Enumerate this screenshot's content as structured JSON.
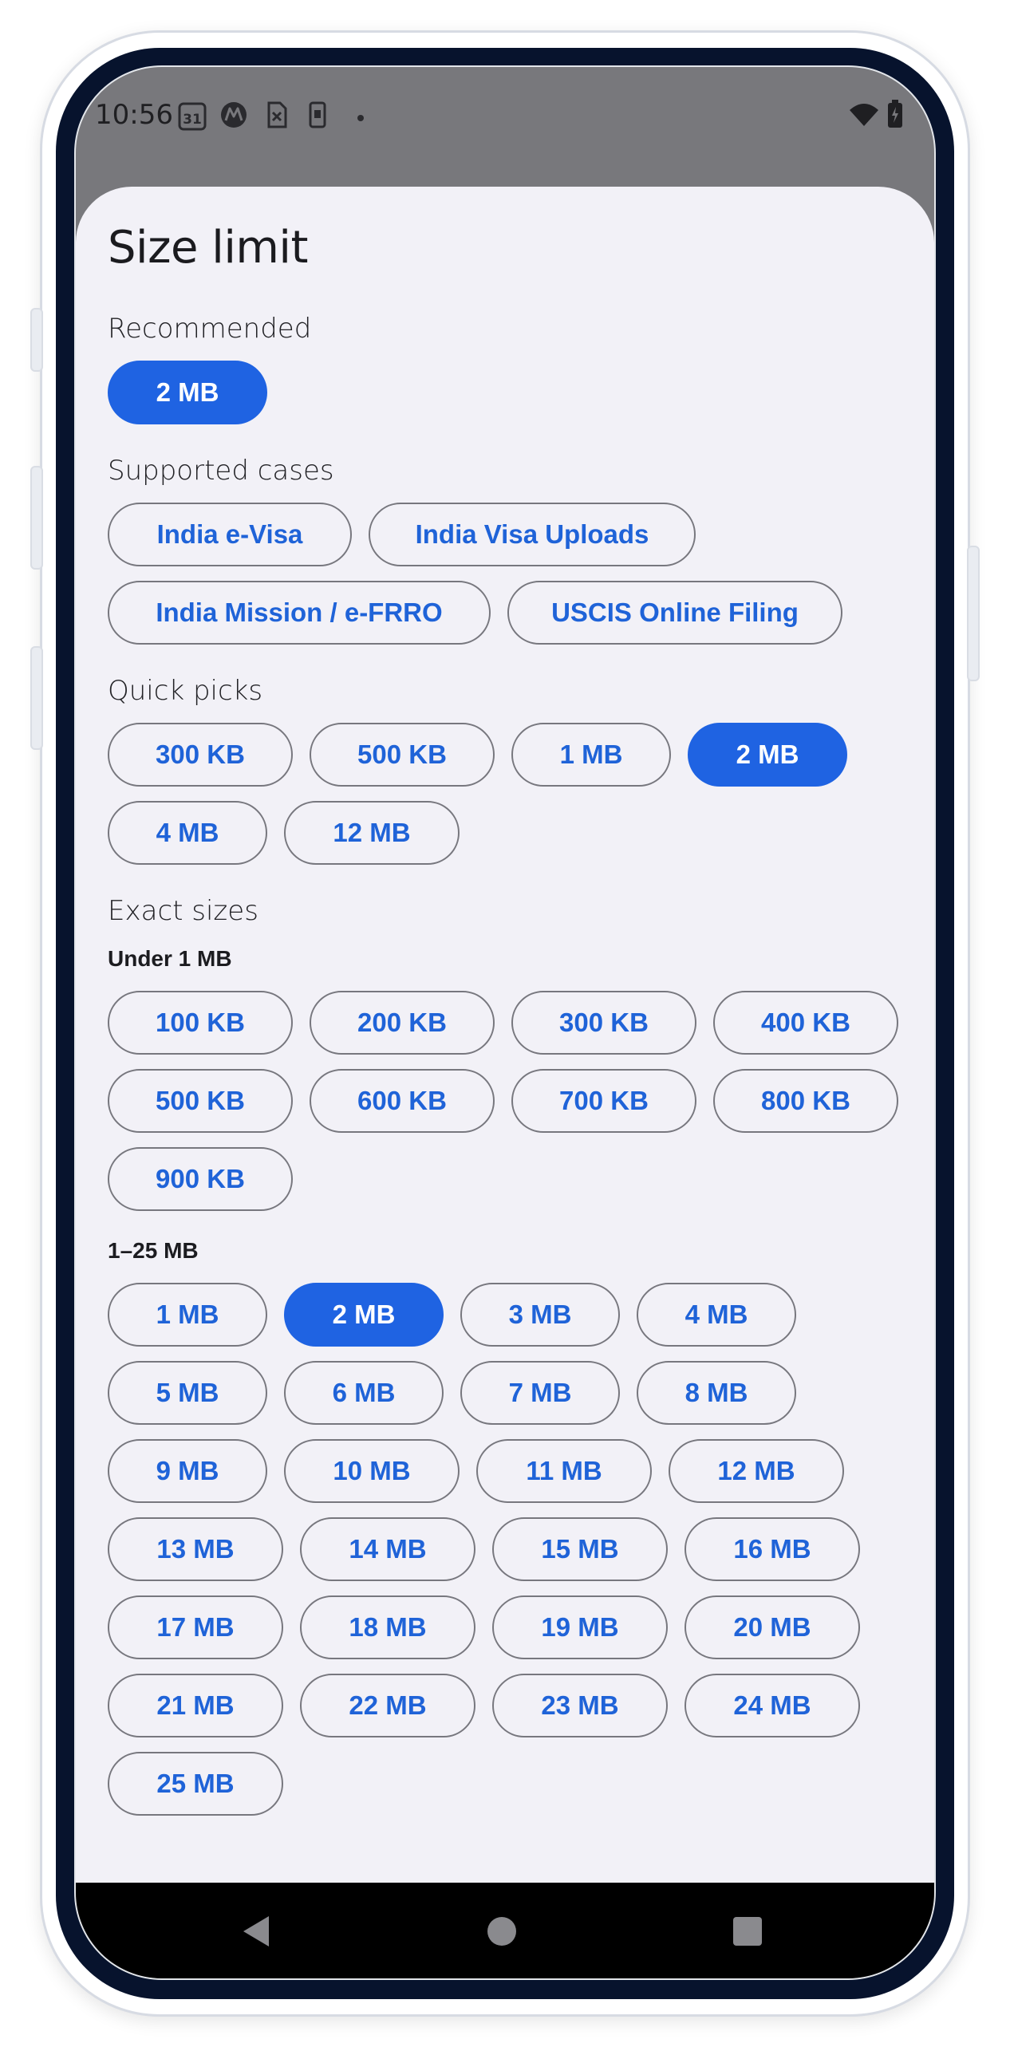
{
  "status_bar": {
    "time": "10:56",
    "icons": [
      "calendar-icon",
      "motorola-icon",
      "sim-card-icon",
      "phone-icon",
      "dot-icon",
      "wifi-icon",
      "battery-icon"
    ],
    "calendar_day": "31"
  },
  "sheet": {
    "title": "Size limit",
    "recommended": {
      "label": "Recommended",
      "chips": [
        {
          "label": "2 MB",
          "selected": true
        }
      ]
    },
    "supported": {
      "label": "Supported cases",
      "rows": [
        [
          {
            "label": "India e-Visa"
          },
          {
            "label": "India Visa Uploads"
          }
        ],
        [
          {
            "label": "India Mission / e-FRRO"
          },
          {
            "label": "USCIS Online Filing"
          }
        ]
      ]
    },
    "quick": {
      "label": "Quick picks",
      "rows": [
        [
          {
            "label": "300 KB"
          },
          {
            "label": "500 KB"
          },
          {
            "label": "1 MB"
          },
          {
            "label": "2 MB",
            "selected": true
          }
        ],
        [
          {
            "label": "4 MB"
          },
          {
            "label": "12 MB"
          }
        ]
      ]
    },
    "exact": {
      "label": "Exact sizes",
      "under1": {
        "label": "Under 1 MB",
        "rows": [
          [
            {
              "label": "100 KB"
            },
            {
              "label": "200 KB"
            },
            {
              "label": "300 KB"
            },
            {
              "label": "400 KB"
            }
          ],
          [
            {
              "label": "500 KB"
            },
            {
              "label": "600 KB"
            },
            {
              "label": "700 KB"
            },
            {
              "label": "800 KB"
            }
          ],
          [
            {
              "label": "900 KB"
            }
          ]
        ]
      },
      "range": {
        "label": "1–25 MB",
        "rows": [
          [
            {
              "label": "1 MB"
            },
            {
              "label": "2 MB",
              "selected": true
            },
            {
              "label": "3 MB"
            },
            {
              "label": "4 MB"
            }
          ],
          [
            {
              "label": "5 MB"
            },
            {
              "label": "6 MB"
            },
            {
              "label": "7 MB"
            },
            {
              "label": "8 MB"
            }
          ],
          [
            {
              "label": "9 MB"
            },
            {
              "label": "10 MB"
            },
            {
              "label": "11 MB"
            },
            {
              "label": "12 MB"
            }
          ],
          [
            {
              "label": "13 MB"
            },
            {
              "label": "14 MB"
            },
            {
              "label": "15 MB"
            },
            {
              "label": "16 MB"
            }
          ],
          [
            {
              "label": "17 MB"
            },
            {
              "label": "18 MB"
            },
            {
              "label": "19 MB"
            },
            {
              "label": "20 MB"
            }
          ],
          [
            {
              "label": "21 MB"
            },
            {
              "label": "22 MB"
            },
            {
              "label": "23 MB"
            },
            {
              "label": "24 MB"
            }
          ],
          [
            {
              "label": "25 MB"
            }
          ]
        ]
      }
    }
  },
  "nav_bar": {
    "buttons": [
      "back-icon",
      "home-icon",
      "recents-icon"
    ]
  },
  "colors": {
    "accent": "#1f63e2",
    "chip_text": "#1f63d8",
    "sheet_bg": "#f2f1f7",
    "scrim": "#78787c"
  }
}
